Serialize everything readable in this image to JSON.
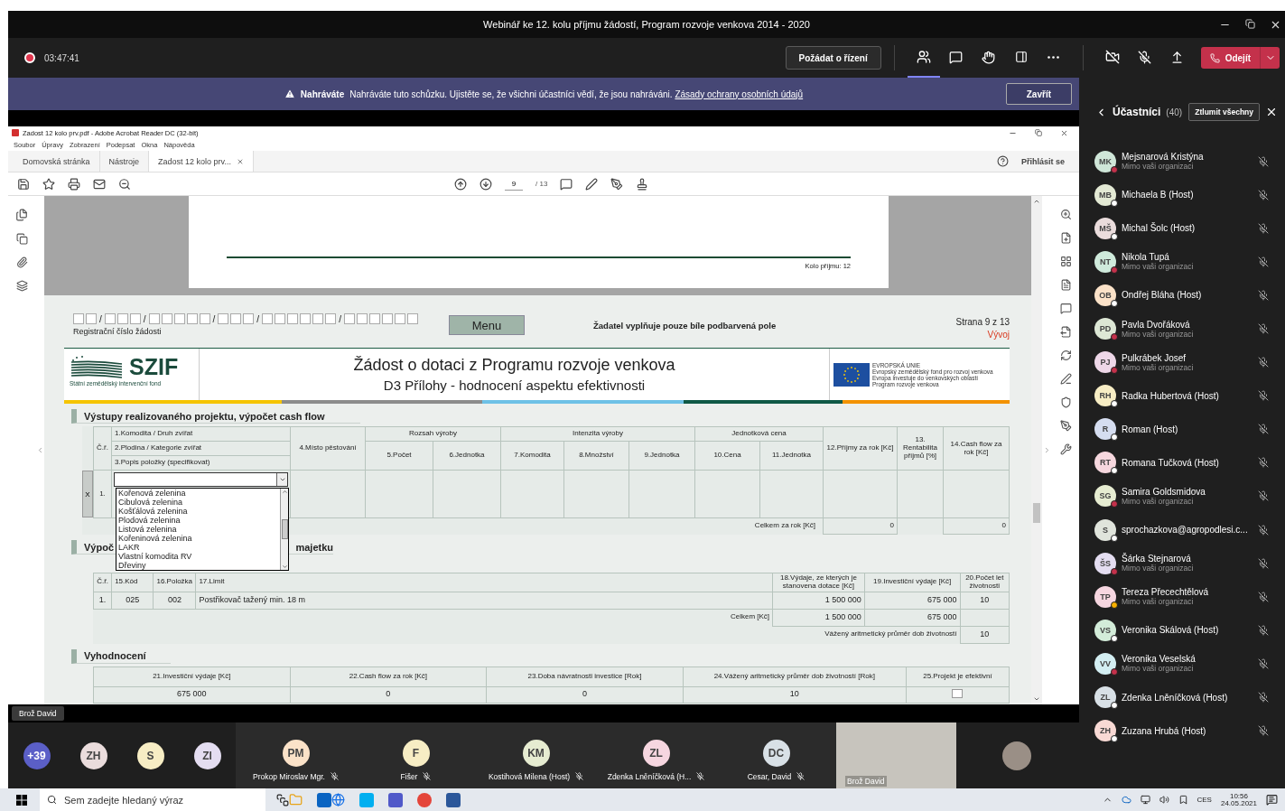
{
  "window": {
    "title": "Webinář ke 12. kolu příjmu žádostí, Program rozvoje venkova 2014 - 2020"
  },
  "meeting_bar": {
    "recording_time": "03:47:41",
    "request_control": "Požádat o řízení",
    "leave": "Odejít"
  },
  "banner": {
    "label": "Nahráváte",
    "message": "Nahráváte tuto schůzku. Ujistěte se, že všichni účastníci vědí, že jsou nahráváni.",
    "link": "Zásady ochrany osobních údajů",
    "close": "Zavřít"
  },
  "acrobat": {
    "title": "Zadost 12 kolo prv.pdf - Adobe Acrobat Reader DC (32-bit)",
    "menu": [
      "Soubor",
      "Úpravy",
      "Zobrazení",
      "Podepsat",
      "Okna",
      "Nápověda"
    ],
    "tabs": [
      {
        "label": "Domovská stránka",
        "selected": false
      },
      {
        "label": "Nástroje",
        "selected": false
      },
      {
        "label": "Zadost 12 kolo prv...",
        "selected": true
      }
    ],
    "sign_in": "Přihlásit se",
    "page": "9",
    "page_total": "/ 13"
  },
  "previous_page": {
    "footer": "Kolo příjmu: 12"
  },
  "form": {
    "registration_separators": [
      "/",
      "/",
      "/",
      "/",
      "/"
    ],
    "registration_label": "Registrační číslo žádosti",
    "menu_button": "Menu",
    "instruction": "Žadatel vyplňuje pouze bíle podbarvená pole",
    "page_label": "Strana 9 z 13",
    "status": "Vývoj",
    "logo_text": "SZIF",
    "logo_caption": "Státní zemědělský intervenční fond",
    "title": "Žádost o dotaci z Programu rozvoje venkova",
    "subtitle": "D3 Přílohy - hodnocení aspektu efektivnosti",
    "eu_lines": [
      "EVROPSKÁ UNIE",
      "Evropský zemědělský fond pro rozvoj venkova",
      "Evropa investuje do venkovských oblastí",
      "Program rozvoje venkova"
    ]
  },
  "cashflow": {
    "title": "Výstupy realizovaného projektu, výpočet cash flow",
    "row_no": "Č.ř.",
    "item_lines": [
      "1.Komodita / Druh zvířat",
      "2.Plodina / Kategorie zvířat",
      "3.Popis položky (specifikovat)"
    ],
    "place": "4.Místo pěstování",
    "groups": [
      {
        "label": "Rozsah výroby",
        "columns": [
          "5.Počet",
          "6.Jednotka"
        ]
      },
      {
        "label": "Intenzita výroby",
        "columns": [
          "7.Komodita",
          "8.Množství",
          "9.Jednotka"
        ]
      },
      {
        "label": "Jednotková cena",
        "columns": [
          "10.Cena",
          "11.Jednotka"
        ]
      }
    ],
    "income": "12.Příjmy za rok [Kč]",
    "profitability": "13. Rentabilita příjmů [%]",
    "cashflow": "14.Cash flow za rok [Kč]",
    "row": {
      "delete": "X",
      "number": "1."
    },
    "options": [
      "Kořenová zelenina",
      "Cibulová zelenina",
      "Košťálová zelenina",
      "Plodová zelenina",
      "Listová zelenina",
      "Kořeninová zelenina",
      "LAKR",
      "Vlastní komodita RV",
      "Dřeviny"
    ],
    "total_label": "Celkem za rok [Kč]",
    "total_income": "0",
    "total_cashflow": "0"
  },
  "assets": {
    "title_parts": [
      "Výpoč",
      "majetku"
    ],
    "headers": [
      "Č.ř.",
      "15.Kód",
      "16.Položka",
      "17.Limit",
      "18.Výdaje, ze kterých je stanovena dotace [Kč]",
      "19.Investiční výdaje [Kč]",
      "20.Počet let životnosti"
    ],
    "rows": [
      [
        "1.",
        "025",
        "002",
        "Postřikovač tažený min. 18 m",
        "1 500 000",
        "675 000",
        "10"
      ]
    ],
    "total_label": "Celkem [Kč]",
    "total_subsidy": "1 500 000",
    "total_investment": "675 000",
    "average_label": "Vážený aritmetický průměr dob životností",
    "average": "10"
  },
  "evaluation": {
    "title": "Vyhodnocení",
    "headers": [
      "21.Investiční výdaje [Kč]",
      "22.Cash flow za rok [Kč]",
      "23.Doba návratnosti investice [Rok]",
      "24.Vážený aritmetický průměr dob životností [Rok]",
      "25.Projekt je efektivní"
    ],
    "values": [
      "675 000",
      "0",
      "0",
      "10"
    ],
    "effective": false
  },
  "shared_screen_label": "Brož David",
  "gallery": {
    "overflow": "+39",
    "avatars": [
      "ZH",
      "S",
      "ZI"
    ],
    "tiles": [
      {
        "kind": "avatar",
        "initials": "PM",
        "name": "Prokop Miroslav Mgr."
      },
      {
        "kind": "avatar",
        "initials": "F",
        "name": "Fišer"
      },
      {
        "kind": "avatar",
        "initials": "KM",
        "name": "Kostihová Milena (Host)"
      },
      {
        "kind": "avatar",
        "initials": "ZL",
        "name": "Zdenka Lněníčková (H..."
      },
      {
        "kind": "avatar",
        "initials": "DC",
        "name": "Cesar, David"
      },
      {
        "kind": "video",
        "name": "Brož David"
      },
      {
        "kind": "photo"
      }
    ]
  },
  "participants": {
    "title": "Účastníci",
    "count": "(40)",
    "mute_all": "Ztlumit všechny",
    "items": [
      {
        "initials": "MK",
        "name": "Mejsnarová Kristýna",
        "note": "Mimo vaši organizaci",
        "color": "#c4314b"
      },
      {
        "initials": "MB",
        "name": "Michaela B (Host)",
        "color": "#ffffff"
      },
      {
        "initials": "MŠ",
        "name": "Michal Šolc (Host)",
        "color": "#ffffff"
      },
      {
        "initials": "NT",
        "name": "Nikola Tupá",
        "note": "Mimo vaši organizaci",
        "color": "#c4314b"
      },
      {
        "initials": "OB",
        "name": "Ondřej Bláha (Host)",
        "color": "#ffffff"
      },
      {
        "initials": "PD",
        "name": "Pavla Dvořáková",
        "note": "Mimo vaši organizaci",
        "color": "#c4314b"
      },
      {
        "initials": "PJ",
        "name": "Pulkrábek Josef",
        "note": "Mimo vaši organizaci",
        "color": "#c4314b"
      },
      {
        "initials": "RH",
        "name": "Radka Hubertová (Host)",
        "color": "#ffffff"
      },
      {
        "initials": "R",
        "name": "Roman (Host)",
        "color": "#ffffff"
      },
      {
        "initials": "RT",
        "name": "Romana Tučková (Host)",
        "color": "#ffffff"
      },
      {
        "initials": "SG",
        "name": "Samira Goldsmidova",
        "note": "Mimo vaši organizaci",
        "color": "#c4314b"
      },
      {
        "initials": "S",
        "name": "sprochazkova@agropodlesi.c...",
        "color": "#ffffff"
      },
      {
        "initials": "ŠS",
        "name": "Šárka Stejnarová",
        "note": "Mimo vaši organizaci",
        "color": "#c4314b"
      },
      {
        "initials": "TP",
        "name": "Tereza Přecechtělová",
        "note": "Mimo vaši organizaci",
        "color": "#f8b000"
      },
      {
        "initials": "VS",
        "name": "Veronika Skálová (Host)",
        "color": "#ffffff"
      },
      {
        "initials": "VV",
        "name": "Veronika Veselská",
        "note": "Mimo vaši organizaci",
        "color": "#c4314b"
      },
      {
        "initials": "ZL",
        "name": "Zdenka Lněníčková (Host)",
        "color": "#ffffff"
      },
      {
        "initials": "ZH",
        "name": "Zuzana Hrubá (Host)",
        "color": "#ffffff"
      }
    ]
  },
  "taskbar": {
    "search_placeholder": "Sem zadejte hledaný výraz",
    "language": "CES",
    "time": "10:56",
    "date": "24.05.2021"
  }
}
